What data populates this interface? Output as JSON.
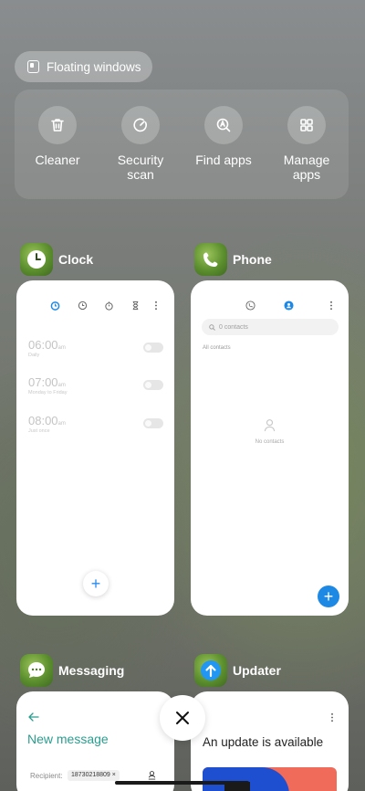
{
  "floating_windows": {
    "label": "Floating windows"
  },
  "tools": [
    {
      "label": "Cleaner",
      "icon": "trash-icon"
    },
    {
      "label": "Security\nscan",
      "icon": "security-scan-icon"
    },
    {
      "label": "Find apps",
      "icon": "find-apps-icon"
    },
    {
      "label": "Manage\napps",
      "icon": "grid-icon"
    }
  ],
  "apps": {
    "clock": {
      "name": "Clock",
      "alarms": [
        {
          "time": "06:00",
          "suffix": "am",
          "repeat": "Daily"
        },
        {
          "time": "07:00",
          "suffix": "am",
          "repeat": "Monday to Friday"
        },
        {
          "time": "08:00",
          "suffix": "am",
          "repeat": "Just once"
        }
      ]
    },
    "phone": {
      "name": "Phone",
      "search_placeholder": "0 contacts",
      "section": "All contacts",
      "empty": "No contacts"
    },
    "messaging": {
      "name": "Messaging",
      "title": "New message",
      "recipient_label": "Recipient:",
      "recipient_value": "18730218809"
    },
    "updater": {
      "name": "Updater",
      "headline": "An update is available"
    }
  },
  "colors": {
    "accent_blue": "#1e88e5",
    "message_title": "#2a9d8f",
    "banner_red": "#f06b5a",
    "banner_blue": "#1f4fd1"
  }
}
